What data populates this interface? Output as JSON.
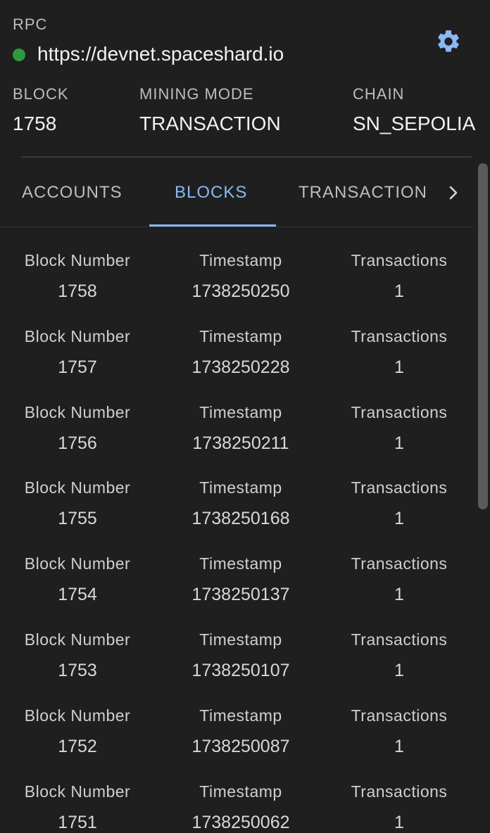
{
  "header": {
    "rpc_label": "RPC",
    "rpc_url": "https://devnet.spaceshard.io",
    "status_color": "#2e9a3f",
    "settings_icon": "gear-icon",
    "stats": {
      "block_label": "BLOCK",
      "block_value": "1758",
      "mining_label": "MINING MODE",
      "mining_value": "TRANSACTION",
      "chain_label": "CHAIN",
      "chain_value": "SN_SEPOLIA"
    }
  },
  "tabs": {
    "items": [
      {
        "label": "ACCOUNTS",
        "active": false
      },
      {
        "label": "BLOCKS",
        "active": true
      },
      {
        "label": "TRANSACTION",
        "active": false
      }
    ],
    "scroll_icon": "chevron-right-icon",
    "accent_color": "#8ab8f2"
  },
  "columns": {
    "block_number": "Block Number",
    "timestamp": "Timestamp",
    "transactions": "Transactions"
  },
  "blocks": [
    {
      "number": "1758",
      "timestamp": "1738250250",
      "transactions": "1"
    },
    {
      "number": "1757",
      "timestamp": "1738250228",
      "transactions": "1"
    },
    {
      "number": "1756",
      "timestamp": "1738250211",
      "transactions": "1"
    },
    {
      "number": "1755",
      "timestamp": "1738250168",
      "transactions": "1"
    },
    {
      "number": "1754",
      "timestamp": "1738250137",
      "transactions": "1"
    },
    {
      "number": "1753",
      "timestamp": "1738250107",
      "transactions": "1"
    },
    {
      "number": "1752",
      "timestamp": "1738250087",
      "transactions": "1"
    },
    {
      "number": "1751",
      "timestamp": "1738250062",
      "transactions": "1"
    }
  ]
}
